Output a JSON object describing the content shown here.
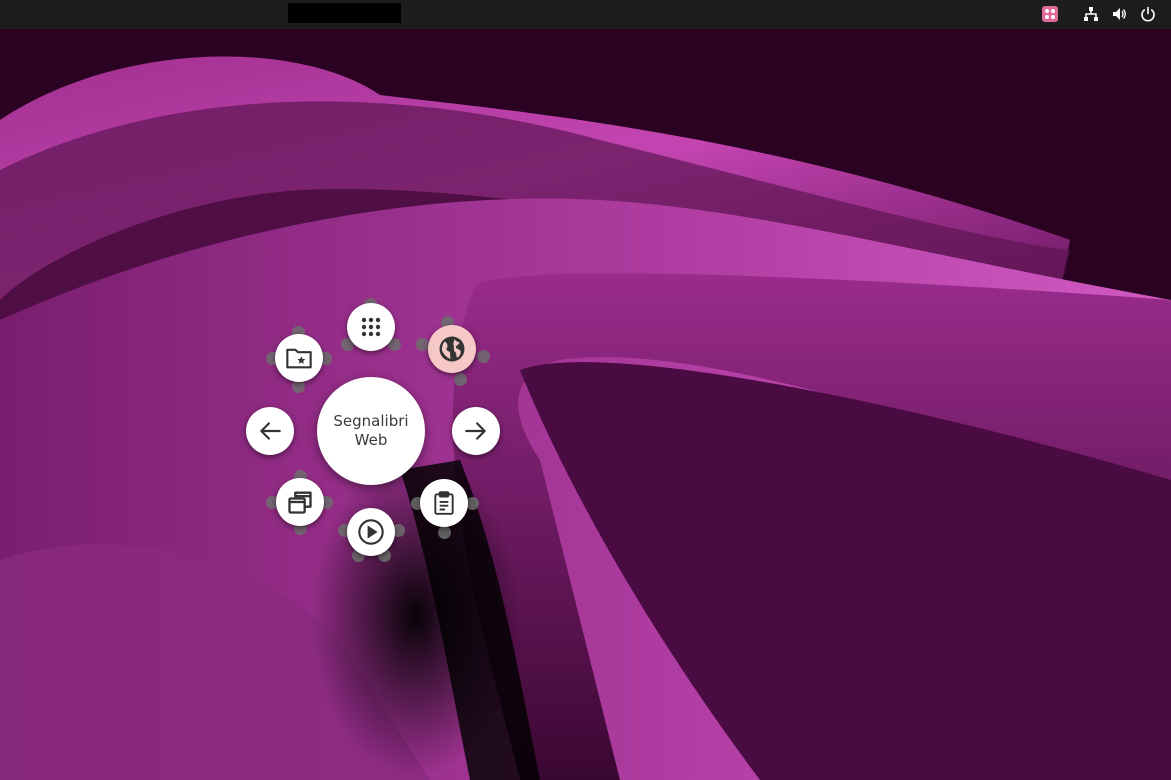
{
  "topbar": {
    "tray_icons": [
      "app-indicator-icon",
      "network-icon",
      "volume-icon",
      "power-icon"
    ],
    "accent_color": "#e06a9a"
  },
  "pie_menu": {
    "center_label_line1": "Segnalibri",
    "center_label_line2": "Web",
    "items": [
      {
        "name": "apps-grid-icon",
        "active": false
      },
      {
        "name": "globe-icon",
        "active": true
      },
      {
        "name": "forward-arrow-icon",
        "active": false
      },
      {
        "name": "clipboard-icon",
        "active": false
      },
      {
        "name": "play-icon",
        "active": false
      },
      {
        "name": "windows-icon",
        "active": false
      },
      {
        "name": "back-arrow-icon",
        "active": false
      },
      {
        "name": "bookmarks-folder-icon",
        "active": false
      }
    ],
    "active_color": "#f6c7c7"
  },
  "wallpaper": {
    "colors": [
      "#2a0020",
      "#b43aa6",
      "#7a1f6e",
      "#000000"
    ]
  }
}
